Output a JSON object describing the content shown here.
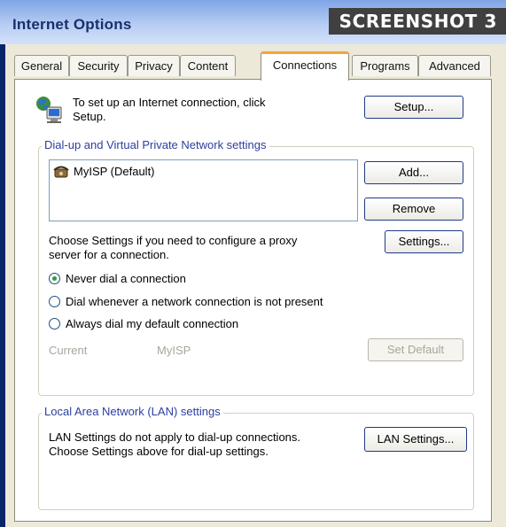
{
  "window": {
    "title": "Internet Options",
    "badge": "SCREENSHOT 3"
  },
  "tabs": [
    {
      "label": "General"
    },
    {
      "label": "Security"
    },
    {
      "label": "Privacy"
    },
    {
      "label": "Content"
    },
    {
      "label": "Connections",
      "active": true
    },
    {
      "label": "Programs"
    },
    {
      "label": "Advanced"
    }
  ],
  "setup": {
    "text_line1": "To set up an Internet connection, click",
    "text_line2": "Setup.",
    "button": "Setup..."
  },
  "dialup": {
    "legend": "Dial-up and Virtual Private Network settings",
    "list_items": [
      "MyISP (Default)"
    ],
    "add_button": "Add...",
    "remove_button": "Remove",
    "proxy_text_line1": "Choose Settings if you need to configure a proxy",
    "proxy_text_line2": "server for a connection.",
    "settings_button": "Settings...",
    "radio_options": [
      {
        "label": "Never dial a connection",
        "selected": true
      },
      {
        "label": "Dial whenever a network connection is not present",
        "selected": false
      },
      {
        "label": "Always dial my default connection",
        "selected": false
      }
    ],
    "current_label": "Current",
    "current_value": "MyISP",
    "set_default_button": "Set Default"
  },
  "lan": {
    "legend": "Local Area Network (LAN) settings",
    "text_line1": "LAN Settings do not apply to dial-up connections.",
    "text_line2": "Choose Settings above for dial-up settings.",
    "button": "LAN Settings..."
  }
}
